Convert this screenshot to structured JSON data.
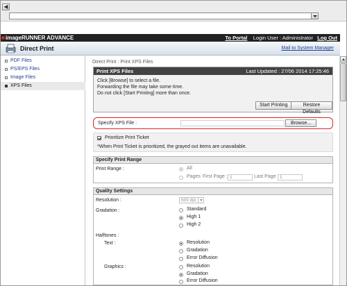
{
  "browser": {
    "nav_icons": [
      "back-icon",
      "forward-icon",
      "refresh-icon",
      "home-icon",
      "dropdown-icon"
    ],
    "address_value": ""
  },
  "header": {
    "brand": "imageRUNNER ADVANCE",
    "to_portal": "To Portal",
    "login_user": "Login User : Administrator",
    "log_out": "Log Out",
    "app_title": "Direct Print",
    "mail_link": "Mail to System Manager"
  },
  "sidebar": {
    "items": [
      {
        "label": "PDF Files"
      },
      {
        "label": "PS/EPS Files"
      },
      {
        "label": "Image Files"
      },
      {
        "label": "XPS Files"
      }
    ]
  },
  "main": {
    "breadcrumb": "Direct Print : Print XPS Files",
    "panel_title": "Print XPS Files",
    "last_updated": "Last Updated : 27/06 2014 17:25:46",
    "instructions": [
      "Click [Browse] to select a file.",
      "Forwarding the file may take some time.",
      "Do not click [Start Printing] more than once."
    ],
    "start_printing": "Start Printing",
    "restore_defaults": "Restore Defaults",
    "specify_file_label": "Specify XPS File :",
    "specify_file_value": "",
    "browse": "Browse...",
    "prioritize_label": "Prioritize Print Ticket",
    "prioritize_checked": true,
    "prioritize_note": "*When Print Ticket is prioritized, the grayed out items are unavailable."
  },
  "print_range": {
    "title": "Specify Print Range",
    "label": "Print Range :",
    "all": "All",
    "pages": "Pages",
    "first_page_label": "First Page :",
    "first_page_value": "1",
    "last_page_label": "Last Page :",
    "last_page_value": "1"
  },
  "quality": {
    "title": "Quality Settings",
    "resolution_label": "Resolution :",
    "resolution_value": "600 dpi",
    "gradation_label": "Gradation :",
    "gradation_options": [
      "Standard",
      "High 1",
      "High 2"
    ],
    "gradation_selected": "High 1",
    "halftones_label": "Halftones :",
    "text_label": "Text :",
    "text_options": [
      "Resolution",
      "Gradation",
      "Error Diffusion"
    ],
    "text_selected": "Resolution",
    "graphics_label": "Graphics :",
    "graphics_options": [
      "Resolution",
      "Gradation",
      "Error Diffusion"
    ],
    "graphics_selected": "Gradation"
  },
  "colors": {
    "app_bar": "#222222",
    "link": "#1c3f94",
    "highlight_border": "#d8262b",
    "panel_head": "#424242"
  }
}
